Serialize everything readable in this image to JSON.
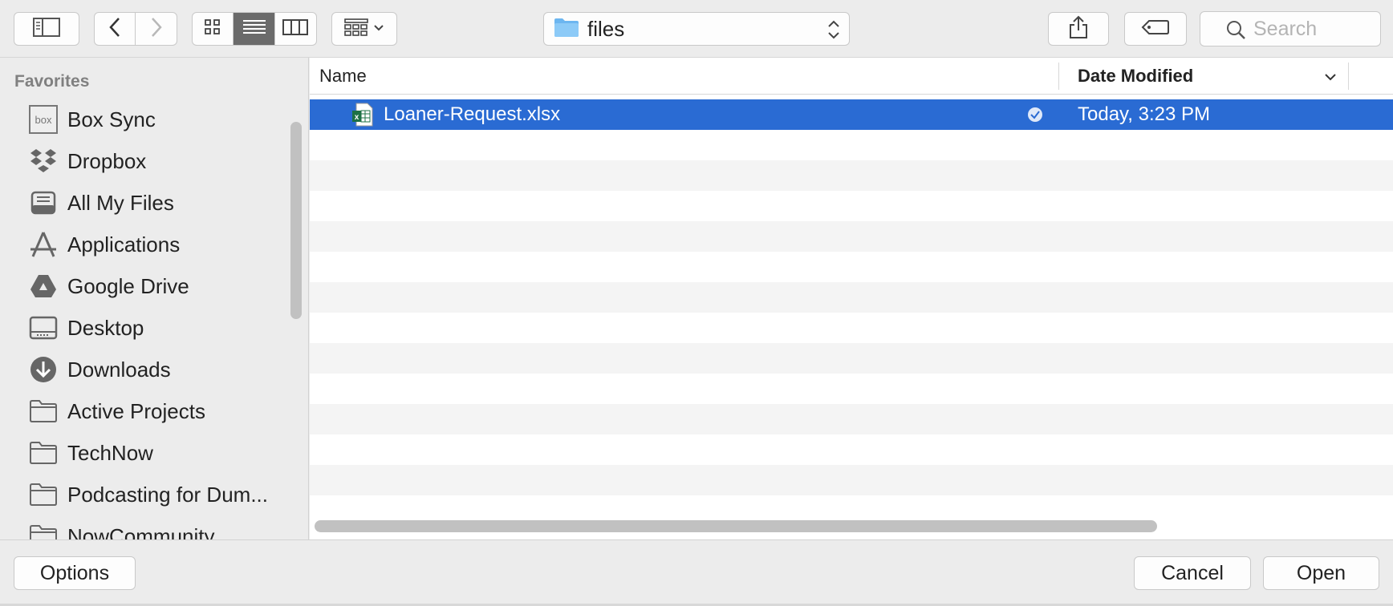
{
  "toolbar": {
    "path_label": "files",
    "search_placeholder": "Search"
  },
  "sidebar": {
    "heading": "Favorites",
    "items": [
      {
        "label": "Box Sync",
        "icon": "box-icon"
      },
      {
        "label": "Dropbox",
        "icon": "dropbox-icon"
      },
      {
        "label": "All My Files",
        "icon": "all-files-icon"
      },
      {
        "label": "Applications",
        "icon": "applications-icon"
      },
      {
        "label": "Google Drive",
        "icon": "google-drive-icon"
      },
      {
        "label": "Desktop",
        "icon": "desktop-icon"
      },
      {
        "label": "Downloads",
        "icon": "downloads-icon"
      },
      {
        "label": "Active Projects",
        "icon": "folder-icon"
      },
      {
        "label": "TechNow",
        "icon": "folder-icon"
      },
      {
        "label": "Podcasting for Dum...",
        "icon": "folder-icon"
      },
      {
        "label": "NowCommunity",
        "icon": "folder-icon"
      }
    ]
  },
  "filelist": {
    "columns": {
      "name": "Name",
      "date": "Date Modified"
    },
    "files": [
      {
        "name": "Loaner-Request.xlsx",
        "date": "Today, 3:23 PM",
        "selected": true,
        "icon": "excel-file-icon"
      }
    ]
  },
  "buttons": {
    "options": "Options",
    "cancel": "Cancel",
    "open": "Open"
  },
  "colors": {
    "selection": "#2a6bd3",
    "folder_blue": "#6cb6f0"
  }
}
